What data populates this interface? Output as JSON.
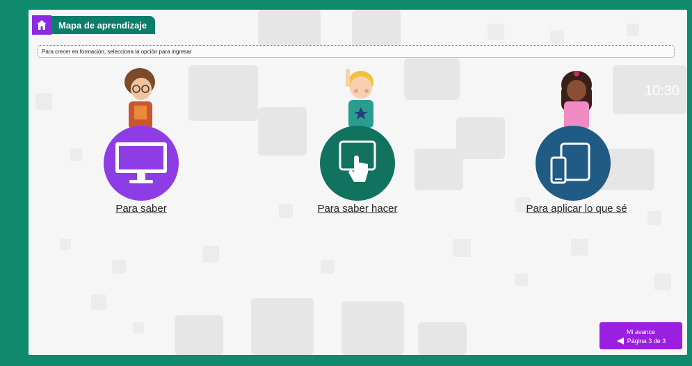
{
  "header": {
    "title": "Mapa de aprendizaje",
    "home_icon": "home-icon"
  },
  "instruction": "Para crecer en formación, selecciona la opción para ingresar",
  "options": [
    {
      "label": "Para saber",
      "icon": "desktop-monitor-icon",
      "color": "#8e3de6"
    },
    {
      "label": "Para saber hacer",
      "icon": "touch-tablet-icon",
      "color": "#11735f"
    },
    {
      "label": "Para aplicar lo que sé",
      "icon": "phone-tablet-icon",
      "color": "#1f5b84"
    }
  ],
  "progress": {
    "title": "Mi avance",
    "page_text": "Página 3 de 3",
    "arrow_icon": "left-triangle-icon",
    "color": "#9b1fe0"
  },
  "background_clock": "10:30",
  "colors": {
    "frame": "#0f8a6c",
    "tab": "#0c7d6a",
    "home": "#8a2be2"
  }
}
